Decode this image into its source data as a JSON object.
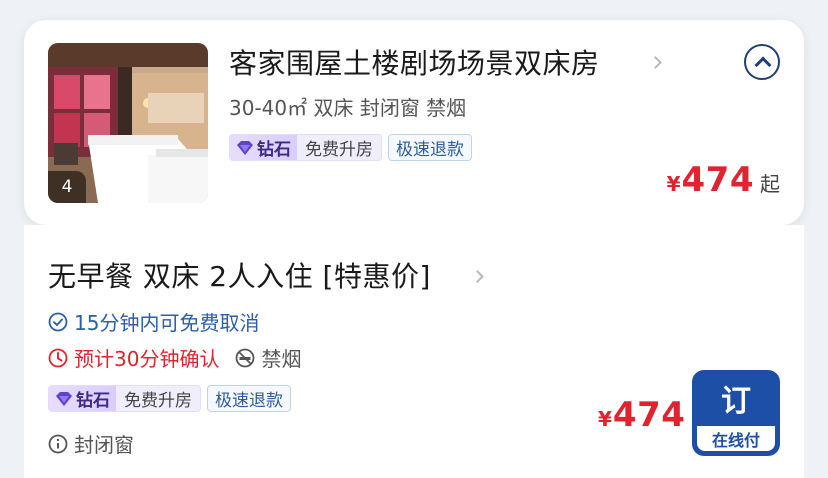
{
  "room": {
    "title": "客家围屋土楼剧场场景双床房",
    "specs": "30-40㎡ 双床 封闭窗 禁烟",
    "photo_count": "4",
    "tags": {
      "diamond": "钻石",
      "upgrade": "免费升房",
      "refund": "极速退款"
    },
    "price": {
      "currency": "¥",
      "amount": "474",
      "suffix": "起"
    }
  },
  "rate": {
    "title": "无早餐 双床 2人入住 [特惠价]",
    "cancel_policy": "15分钟内可免费取消",
    "confirm_time": "预计30分钟确认",
    "smoking": "禁烟",
    "tags": {
      "diamond": "钻石",
      "upgrade": "免费升房",
      "refund": "极速退款"
    },
    "window": "封闭窗",
    "price": {
      "currency": "¥",
      "amount": "474"
    },
    "book": {
      "label": "订",
      "payment": "在线付"
    }
  },
  "colors": {
    "price_red": "#e0242f",
    "brand_blue": "#1d4fa6",
    "cancel_blue": "#2b5fa8",
    "diamond_purple": "#3b2a86"
  },
  "icons": {
    "collapse": "chevron-up-circle-icon",
    "cancel": "check-circle-icon",
    "confirm": "clock-icon",
    "smoking": "no-smoking-icon",
    "window": "info-circle-icon",
    "diamond": "diamond-icon"
  }
}
